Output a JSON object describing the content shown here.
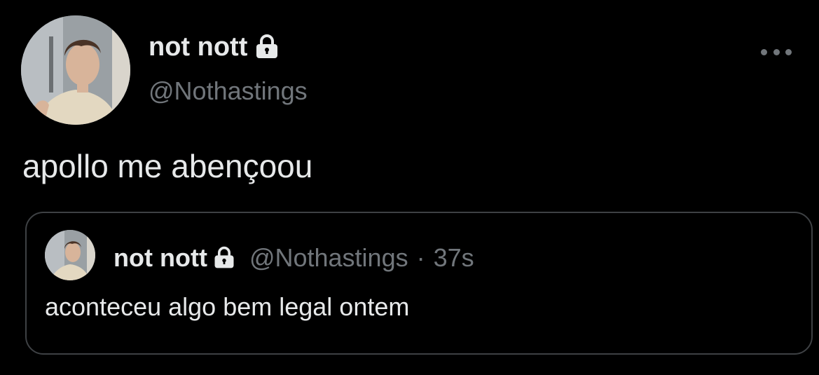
{
  "tweet": {
    "display_name": "not nott",
    "handle": "@Nothastings",
    "text": "apollo me abençoou",
    "protected_icon": "lock-icon",
    "more_icon": "more-horizontal-icon"
  },
  "quote": {
    "display_name": "not nott",
    "handle": "@Nothastings",
    "separator": "·",
    "time": "37s",
    "text": "aconteceu algo bem legal ontem",
    "protected_icon": "lock-icon"
  },
  "colors": {
    "background": "#000000",
    "primary_text": "#e7e9ea",
    "secondary_text": "#71767b",
    "border": "#3e4144"
  }
}
